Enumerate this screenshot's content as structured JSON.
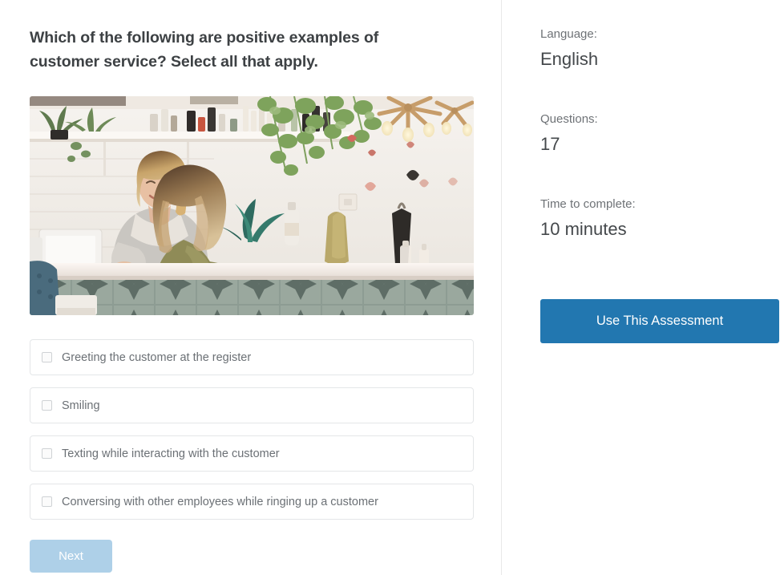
{
  "question": {
    "title": "Which of the following are positive examples of customer service? Select all that apply.",
    "image_alt": "A customer at a salon front desk being greeted by a smiling employee at the register",
    "options": [
      {
        "label": "Greeting the customer at the register",
        "checked": false
      },
      {
        "label": "Smiling",
        "checked": false
      },
      {
        "label": "Texting while interacting with the customer",
        "checked": false
      },
      {
        "label": "Conversing with other employees while ringing up a customer",
        "checked": false
      }
    ],
    "next_label": "Next"
  },
  "meta": {
    "language_label": "Language:",
    "language_value": "English",
    "questions_label": "Questions:",
    "questions_value": "17",
    "time_label": "Time to complete:",
    "time_value": "10 minutes",
    "cta_label": "Use This Assessment"
  },
  "colors": {
    "cta_blue": "#2277b0",
    "next_disabled_blue": "#aed0e8",
    "title_text": "#3d4144",
    "option_text": "#6b7075",
    "divider": "#e8e8e8"
  }
}
